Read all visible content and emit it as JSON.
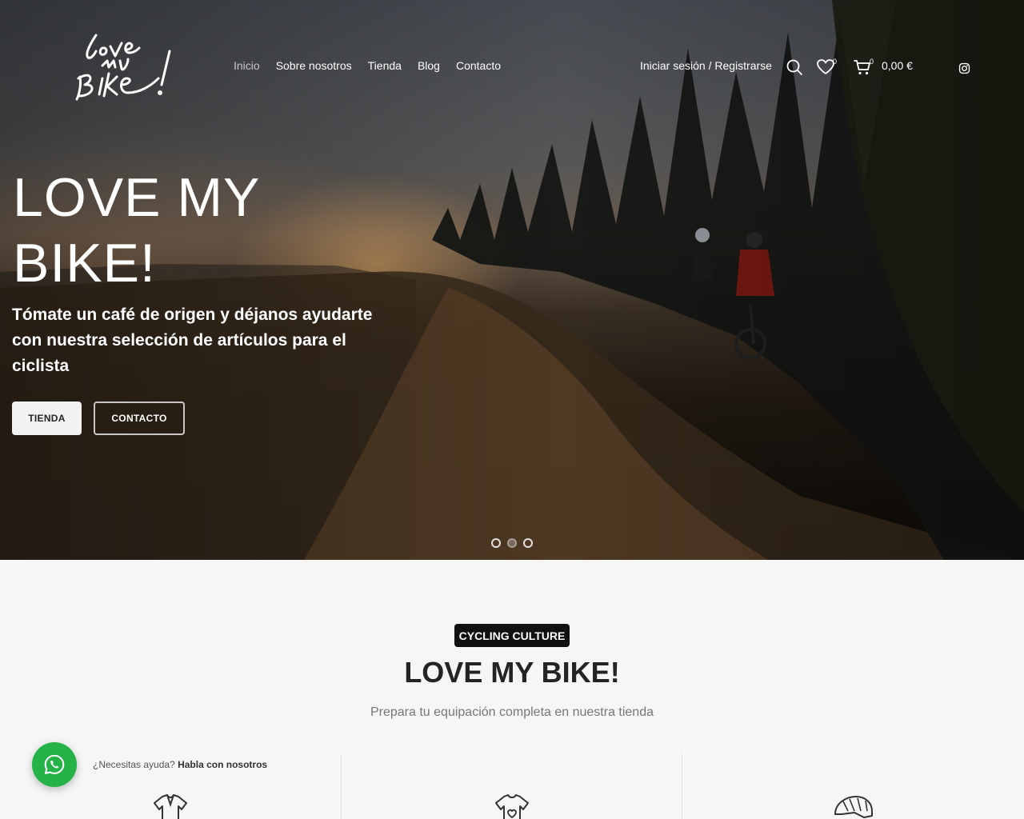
{
  "header": {
    "logo_alt": "love my bike!",
    "nav": [
      {
        "label": "Inicio",
        "active": true
      },
      {
        "label": "Sobre nosotros"
      },
      {
        "label": "Tienda"
      },
      {
        "label": "Blog"
      },
      {
        "label": "Contacto"
      }
    ],
    "login_label": "Iniciar sesión / Registrarse",
    "wishlist_count": "0",
    "cart_count": "0",
    "cart_total": "0,00 €",
    "icons": [
      "search-icon",
      "heart-icon",
      "cart-icon",
      "instagram-icon"
    ]
  },
  "hero": {
    "title": "LOVE MY BIKE!",
    "subtitle": "Tómate un café de origen y déjanos ayudarte con nuestra selección de artículos para el ciclista",
    "primary_button": "TIENDA",
    "secondary_button": "CONTACTO",
    "slides": 3,
    "active_slide": 2
  },
  "section": {
    "tag": "CYCLING CULTURE",
    "title": "LOVE MY BIKE!",
    "subtitle": "Prepara tu equipación completa en nuestra tienda",
    "feature_icons": [
      "jersey-icon",
      "tshirt-heart-icon",
      "helmet-icon"
    ]
  },
  "whatsapp": {
    "prompt": "¿Necesitas ayuda?",
    "cta": "Habla con nosotros",
    "color": "#25b347"
  }
}
